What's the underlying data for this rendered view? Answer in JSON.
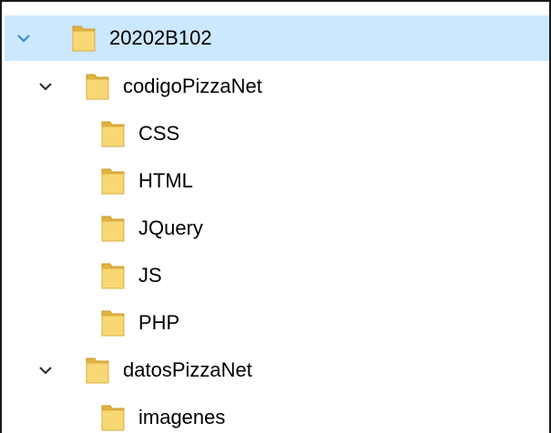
{
  "tree": {
    "root": {
      "label": "20202B102",
      "selected": true,
      "expanded": true
    },
    "items": [
      {
        "label": "codigoPizzaNet",
        "expanded": true,
        "children": [
          {
            "label": "CSS"
          },
          {
            "label": "HTML"
          },
          {
            "label": "JQuery"
          },
          {
            "label": "JS"
          },
          {
            "label": "PHP"
          }
        ]
      },
      {
        "label": "datosPizzaNet",
        "expanded": true,
        "children": [
          {
            "label": "imagenes"
          }
        ]
      }
    ]
  },
  "colors": {
    "selection_bg": "#cce8ff",
    "chevron_selected": "#3a8bd6",
    "chevron": "#333333",
    "folder_fill": "#f8d775",
    "folder_back": "#e3b340"
  }
}
